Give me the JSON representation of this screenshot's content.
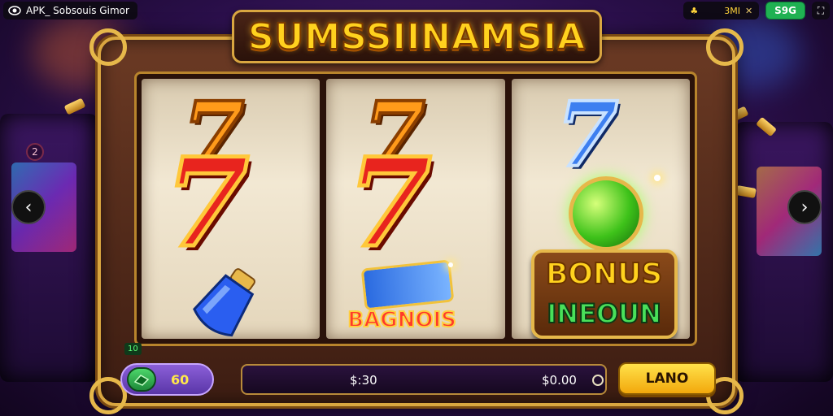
{
  "topbar": {
    "app_label": "APK_ Sobsouis Gimor",
    "stat_value": "3MI",
    "balance_label": "S9G"
  },
  "title": "SUMSSIINAMSIA",
  "reels": {
    "reel1": {
      "top": "7",
      "front": "7"
    },
    "reel2": {
      "top": "7",
      "front": "7",
      "badge": "BAGNOIS"
    },
    "reel3": {
      "top": "7",
      "bonus_line1": "BONUS",
      "bonus_line2": "INEOUN"
    }
  },
  "side_badge": "2",
  "bottom": {
    "tiny_tag": "10",
    "coin_value": "60",
    "bet_display": "$:30",
    "win_display": "$0.00",
    "spin_label": "LANO"
  },
  "colors": {
    "accent_gold": "#d9a640",
    "title_yellow": "#ffd21e",
    "spin_yellow": "#ffe14a",
    "coin_green": "#1fb152",
    "bg_purple": "#2a0f4a"
  },
  "icons": {
    "app": "eye-logo-icon",
    "left_nav": "chevron-left-icon",
    "right_nav": "chevron-right-icon",
    "expand": "expand-icon",
    "coin": "coin-stack-icon"
  }
}
